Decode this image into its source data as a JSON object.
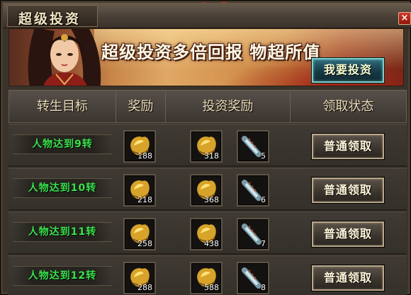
{
  "window": {
    "title": "超级投资",
    "close_label": "×"
  },
  "banner": {
    "slogan": "超级投资多倍回报 物超所值",
    "invest_button": "我要投资"
  },
  "table": {
    "headers": [
      "转生目标",
      "奖励",
      "投资奖励",
      "领取状态"
    ],
    "rows": [
      {
        "target": "人物达到9转",
        "reward": "188",
        "invest_reward": "318",
        "invest_extra": "5",
        "status": "普通领取"
      },
      {
        "target": "人物达到10转",
        "reward": "218",
        "invest_reward": "368",
        "invest_extra": "6",
        "status": "普通领取"
      },
      {
        "target": "人物达到11转",
        "reward": "258",
        "invest_reward": "438",
        "invest_extra": "7",
        "status": "普通领取"
      },
      {
        "target": "人物达到12转",
        "reward": "288",
        "invest_reward": "588",
        "invest_extra": "8",
        "status": "普通领取"
      }
    ]
  },
  "icons": {
    "gold": "gold-ingot-icon",
    "scroll": "scroll-icon",
    "close": "close-icon"
  },
  "colors": {
    "target_text": "#39e24d",
    "title_text": "#f3e4c2",
    "button_border": "#b9a788",
    "invest_button_border": "#7bd0c9"
  }
}
